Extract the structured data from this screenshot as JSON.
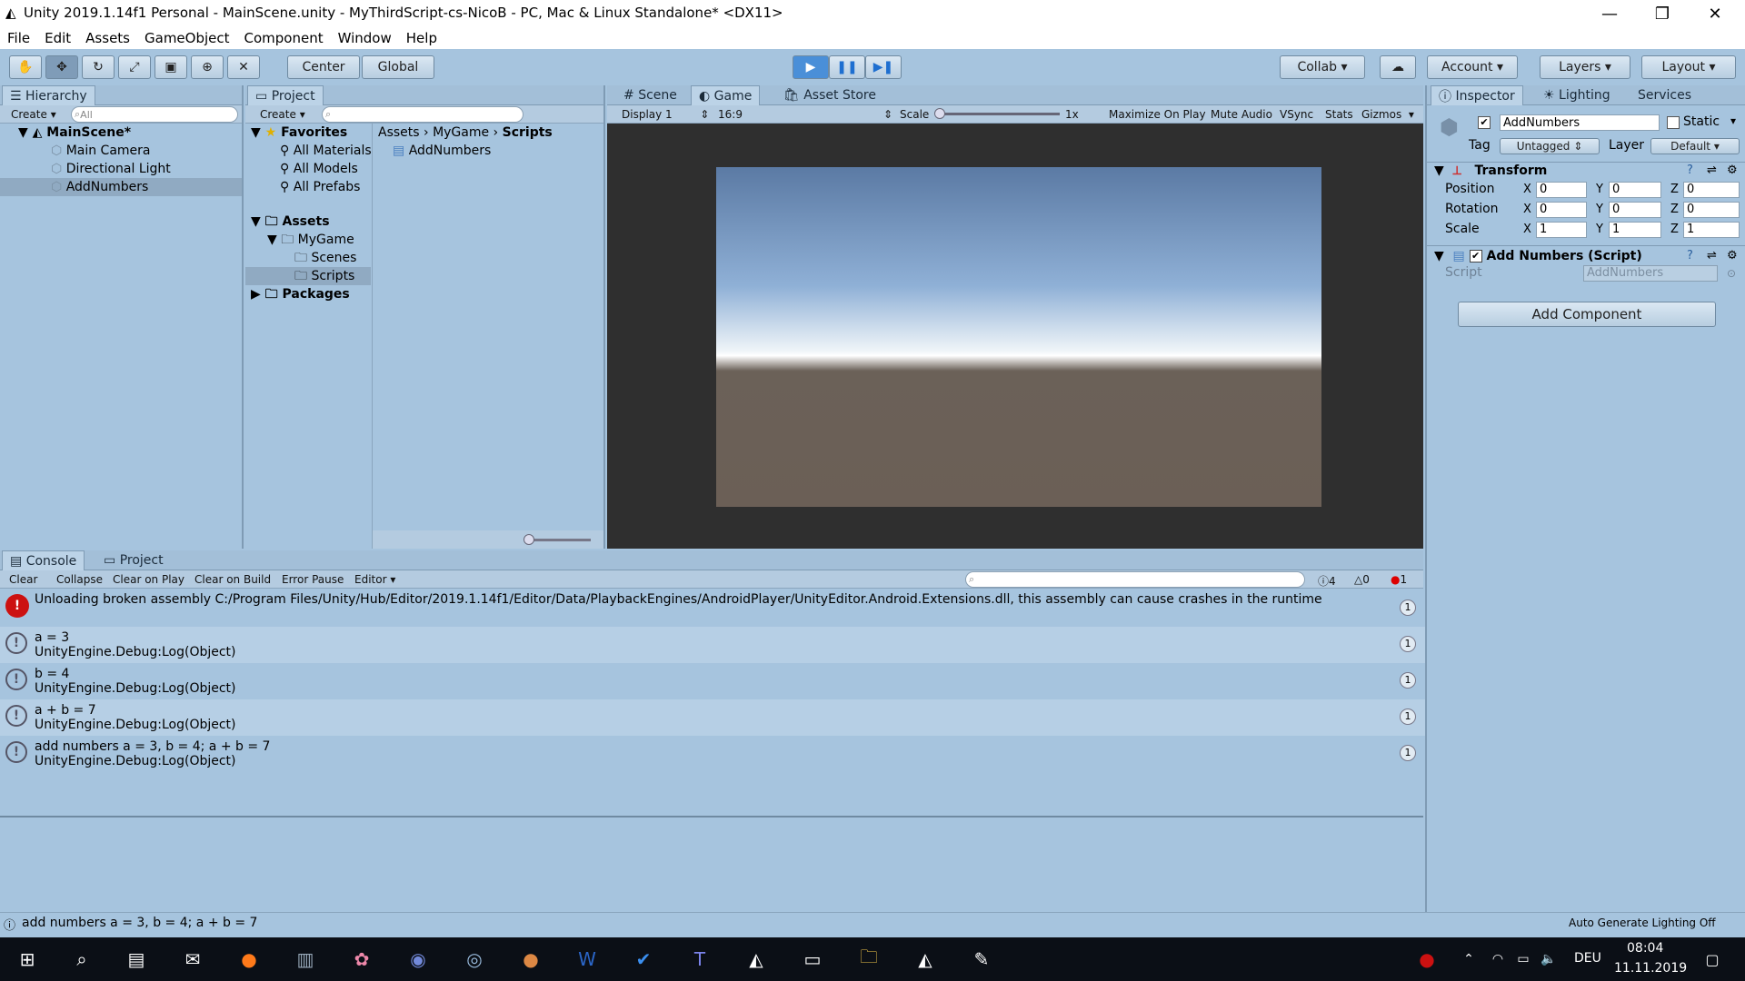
{
  "window": {
    "title": "Unity 2019.1.14f1 Personal - MainScene.unity - MyThirdScript-cs-NicoB - PC, Mac & Linux Standalone* <DX11>",
    "minimize": "—",
    "maximize": "❐",
    "close": "✕"
  },
  "menu": [
    "File",
    "Edit",
    "Assets",
    "GameObject",
    "Component",
    "Window",
    "Help"
  ],
  "toolbar": {
    "tools": [
      "hand-icon",
      "move-icon",
      "rotate-icon",
      "scale-icon",
      "rect-icon",
      "transform-icon",
      "custom-icon"
    ],
    "center": "Center",
    "global": "Global",
    "play": "▶",
    "pause": "❚❚",
    "step": "▶❚",
    "collab": "Collab",
    "account": "Account",
    "layers": "Layers",
    "layout": "Layout"
  },
  "hierarchy": {
    "tab": "Hierarchy",
    "create": "Create",
    "search_placeholder": "All",
    "scene": "MainScene*",
    "items": [
      "Main Camera",
      "Directional Light",
      "AddNumbers"
    ]
  },
  "project": {
    "tab": "Project",
    "create": "Create",
    "favorites": "Favorites",
    "favorites_items": [
      "All Materials",
      "All Models",
      "All Prefabs"
    ],
    "assets": "Assets",
    "mygame": "MyGame",
    "scenes": "Scenes",
    "scripts": "Scripts",
    "packages": "Packages",
    "breadcrumb": [
      "Assets",
      "MyGame",
      "Scripts"
    ],
    "file": "AddNumbers"
  },
  "view_tabs": {
    "scene": "Scene",
    "game": "Game",
    "asset_store": "Asset Store"
  },
  "game_bar": {
    "display": "Display 1",
    "aspect": "16:9",
    "scale_label": "Scale",
    "scale_value": "1x",
    "maximize": "Maximize On Play",
    "mute": "Mute Audio",
    "vsync": "VSync",
    "stats": "Stats",
    "gizmos": "Gizmos"
  },
  "inspector": {
    "tabs": [
      "Inspector",
      "Lighting",
      "Services"
    ],
    "object_name": "AddNumbers",
    "static": "Static",
    "tag_label": "Tag",
    "tag_value": "Untagged",
    "layer_label": "Layer",
    "layer_value": "Default",
    "transform": "Transform",
    "position": "Position",
    "rotation": "Rotation",
    "scale": "Scale",
    "pos": [
      "0",
      "0",
      "0"
    ],
    "rot": [
      "0",
      "0",
      "0"
    ],
    "scl": [
      "1",
      "1",
      "1"
    ],
    "axis": [
      "X",
      "Y",
      "Z"
    ],
    "script_component": "Add Numbers (Script)",
    "script_label": "Script",
    "script_value": "AddNumbers",
    "add_component": "Add Component"
  },
  "console": {
    "tab": "Console",
    "project_tab": "Project",
    "buttons": [
      "Clear",
      "Collapse",
      "Clear on Play",
      "Clear on Build",
      "Error Pause",
      "Editor"
    ],
    "count_log": "4",
    "count_warn": "0",
    "count_error": "1",
    "entries": [
      {
        "line1": "Unloading broken assembly C:/Program Files/Unity/Hub/Editor/2019.1.14f1/Editor/Data/PlaybackEngines/AndroidPlayer/UnityEditor.Android.Extensions.dll, this assembly can cause crashes in the runtime",
        "line2": "",
        "count": "1",
        "type": "error"
      },
      {
        "line1": "a = 3",
        "line2": "UnityEngine.Debug:Log(Object)",
        "count": "1",
        "type": "log"
      },
      {
        "line1": "b = 4",
        "line2": "UnityEngine.Debug:Log(Object)",
        "count": "1",
        "type": "log"
      },
      {
        "line1": "a + b = 7",
        "line2": "UnityEngine.Debug:Log(Object)",
        "count": "1",
        "type": "log"
      },
      {
        "line1": "add numbers a = 3, b = 4; a + b = 7",
        "line2": "UnityEngine.Debug:Log(Object)",
        "count": "1",
        "type": "log"
      }
    ]
  },
  "status": {
    "message": "add numbers a = 3, b = 4; a + b = 7",
    "right": "Auto Generate Lighting Off"
  },
  "taskbar": {
    "lang": "DEU",
    "time": "08:04",
    "date": "11.11.2019"
  }
}
